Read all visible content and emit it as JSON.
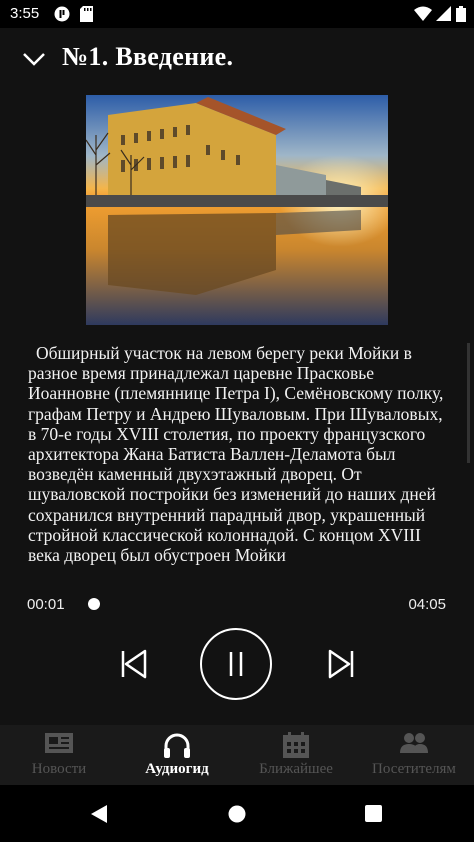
{
  "status_bar": {
    "time": "3:55"
  },
  "header": {
    "title": "№1. Введение."
  },
  "article": {
    "text": "Обширный участок на левом берегу реки Мойки в разное время принадлежал царевне Прасковье Иоанновне (племяннице Петра I), Семёновскому полку, графам Петру и Андрею Шуваловым. При Шуваловых, в 70-е годы XVIII столетия, по проекту французского архитектора Жана Батиста Валлен-Деламота был возведён каменный двухэтажный дворец. От шуваловской постройки без изменений до наших дней сохранился внутренний парадный двор, украшенный стройной классической колоннадой. С концом XVIII века дворец был обустроен Мойки"
  },
  "player": {
    "current_time": "00:01",
    "total_time": "04:05",
    "progress": 0.004,
    "state": "playing"
  },
  "bottom_nav": {
    "items": [
      {
        "label": "Новости",
        "icon": "newspaper-icon",
        "active": false
      },
      {
        "label": "Аудиогид",
        "icon": "headphones-icon",
        "active": true
      },
      {
        "label": "Ближайшее",
        "icon": "calendar-icon",
        "active": false
      },
      {
        "label": "Посетителям",
        "icon": "people-icon",
        "active": false
      }
    ]
  },
  "colors": {
    "background": "#121212",
    "active_tab": "#ffffff",
    "inactive_tab": "#555555"
  }
}
